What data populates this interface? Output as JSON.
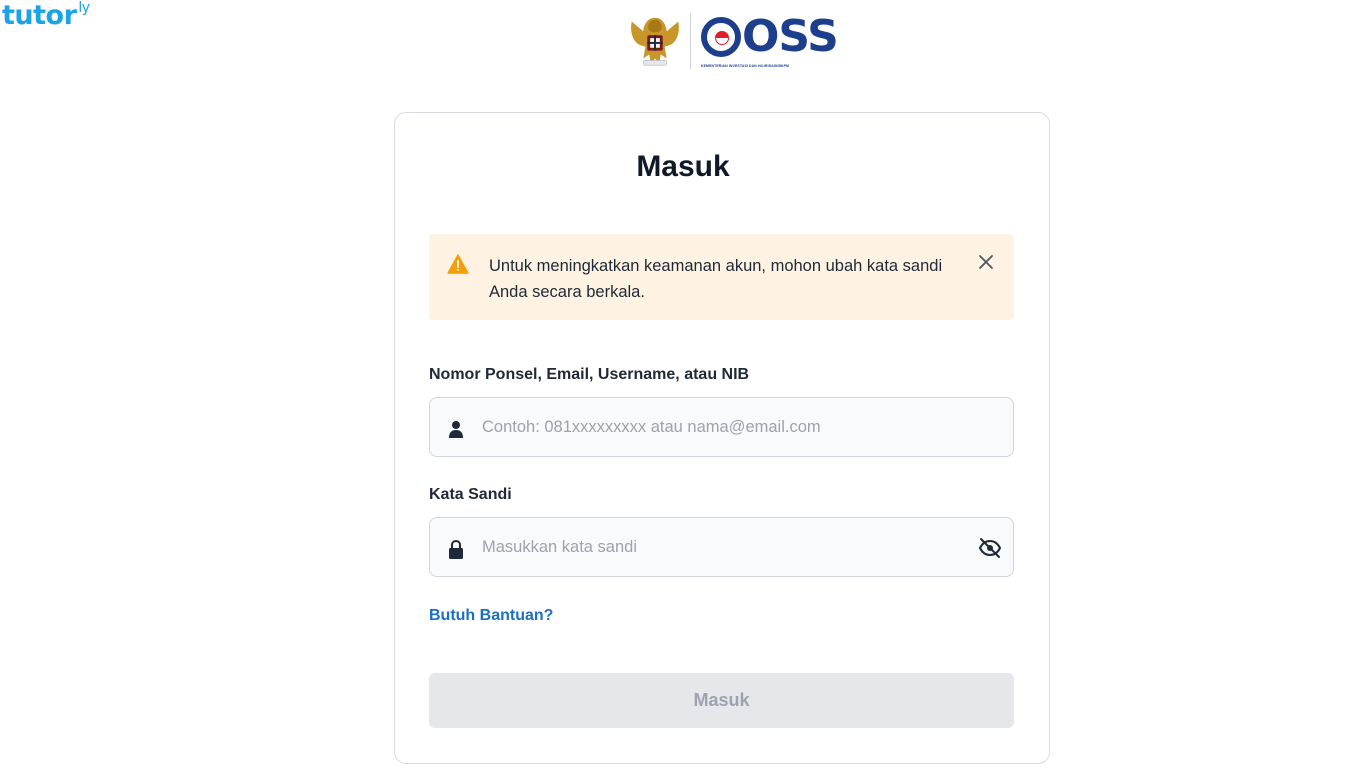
{
  "watermark": {
    "text": "tutor",
    "suffix": "ly"
  },
  "header": {
    "brand": "OSS",
    "brand_subtitle": "KEMENTERIAN INVESTASI DAN HILIRISASI/BKPM"
  },
  "login": {
    "title": "Masuk",
    "alert": {
      "message": "Untuk meningkatkan keamanan akun, mohon ubah kata sandi Anda secara berkala."
    },
    "identity_field": {
      "label": "Nomor Ponsel, Email, Username, atau NIB",
      "placeholder": "Contoh: 081xxxxxxxxx atau nama@email.com",
      "value": ""
    },
    "password_field": {
      "label": "Kata Sandi",
      "placeholder": "Masukkan kata sandi",
      "value": ""
    },
    "help_link": "Butuh Bantuan?",
    "submit_label": "Masuk"
  },
  "colors": {
    "brand_blue": "#1c3e8c",
    "alert_bg": "#fef3e2",
    "warning_orange": "#f59e0b",
    "link_blue": "#1d6fc4",
    "button_disabled_bg": "#e5e7eb"
  },
  "icons": [
    "garuda-emblem",
    "warning-icon",
    "close-icon",
    "user-icon",
    "lock-icon",
    "eye-off-icon"
  ]
}
